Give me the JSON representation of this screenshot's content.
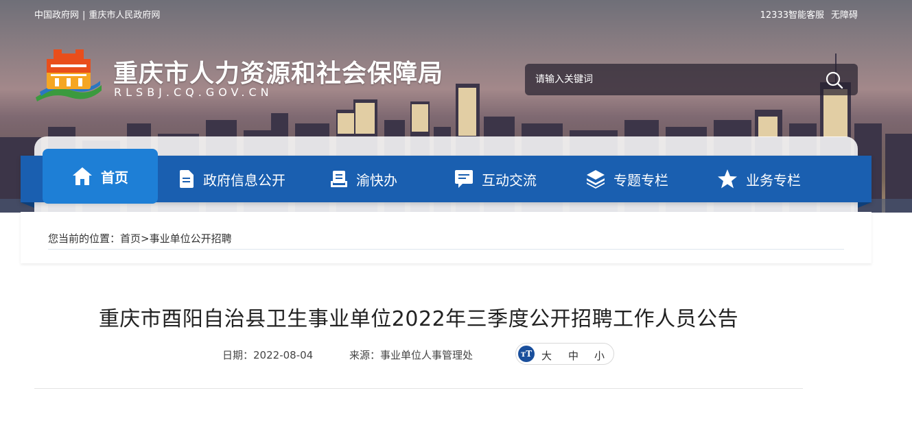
{
  "header": {
    "top_links_left": [
      "中国政府网",
      "重庆市人民政府网"
    ],
    "top_links_separator": "|",
    "top_links_right": [
      "12333智能客服",
      "无障碍"
    ],
    "site_title": "重庆市人力资源和社会保障局",
    "site_domain": "RLSBJ.CQ.GOV.CN",
    "search": {
      "placeholder": "请输入关键词",
      "icon": "search-icon"
    }
  },
  "nav": {
    "items": [
      {
        "label": "首页",
        "icon": "home-icon",
        "active": true
      },
      {
        "label": "政府信息公开",
        "icon": "document-icon",
        "active": false
      },
      {
        "label": "渝快办",
        "icon": "clipboard-icon",
        "active": false
      },
      {
        "label": "互动交流",
        "icon": "chat-icon",
        "active": false
      },
      {
        "label": "专题专栏",
        "icon": "layers-icon",
        "active": false
      },
      {
        "label": "业务专栏",
        "icon": "star-icon",
        "active": false
      }
    ]
  },
  "breadcrumb": {
    "prefix": "您当前的位置：",
    "items": [
      "首页",
      "事业单位公开招聘"
    ],
    "separator": ">"
  },
  "article": {
    "title": "重庆市酉阳自治县卫生事业单位2022年三季度公开招聘工作人员公告",
    "date_label": "日期：",
    "date": "2022-08-04",
    "source_label": "来源：",
    "source": "事业单位人事管理处",
    "font_size": {
      "badge": "тT",
      "options": [
        "大",
        "中",
        "小"
      ]
    }
  },
  "colors": {
    "nav_bg": "#1a5fb0",
    "nav_active": "#1e7fd6",
    "badge": "#1a4f9c"
  }
}
